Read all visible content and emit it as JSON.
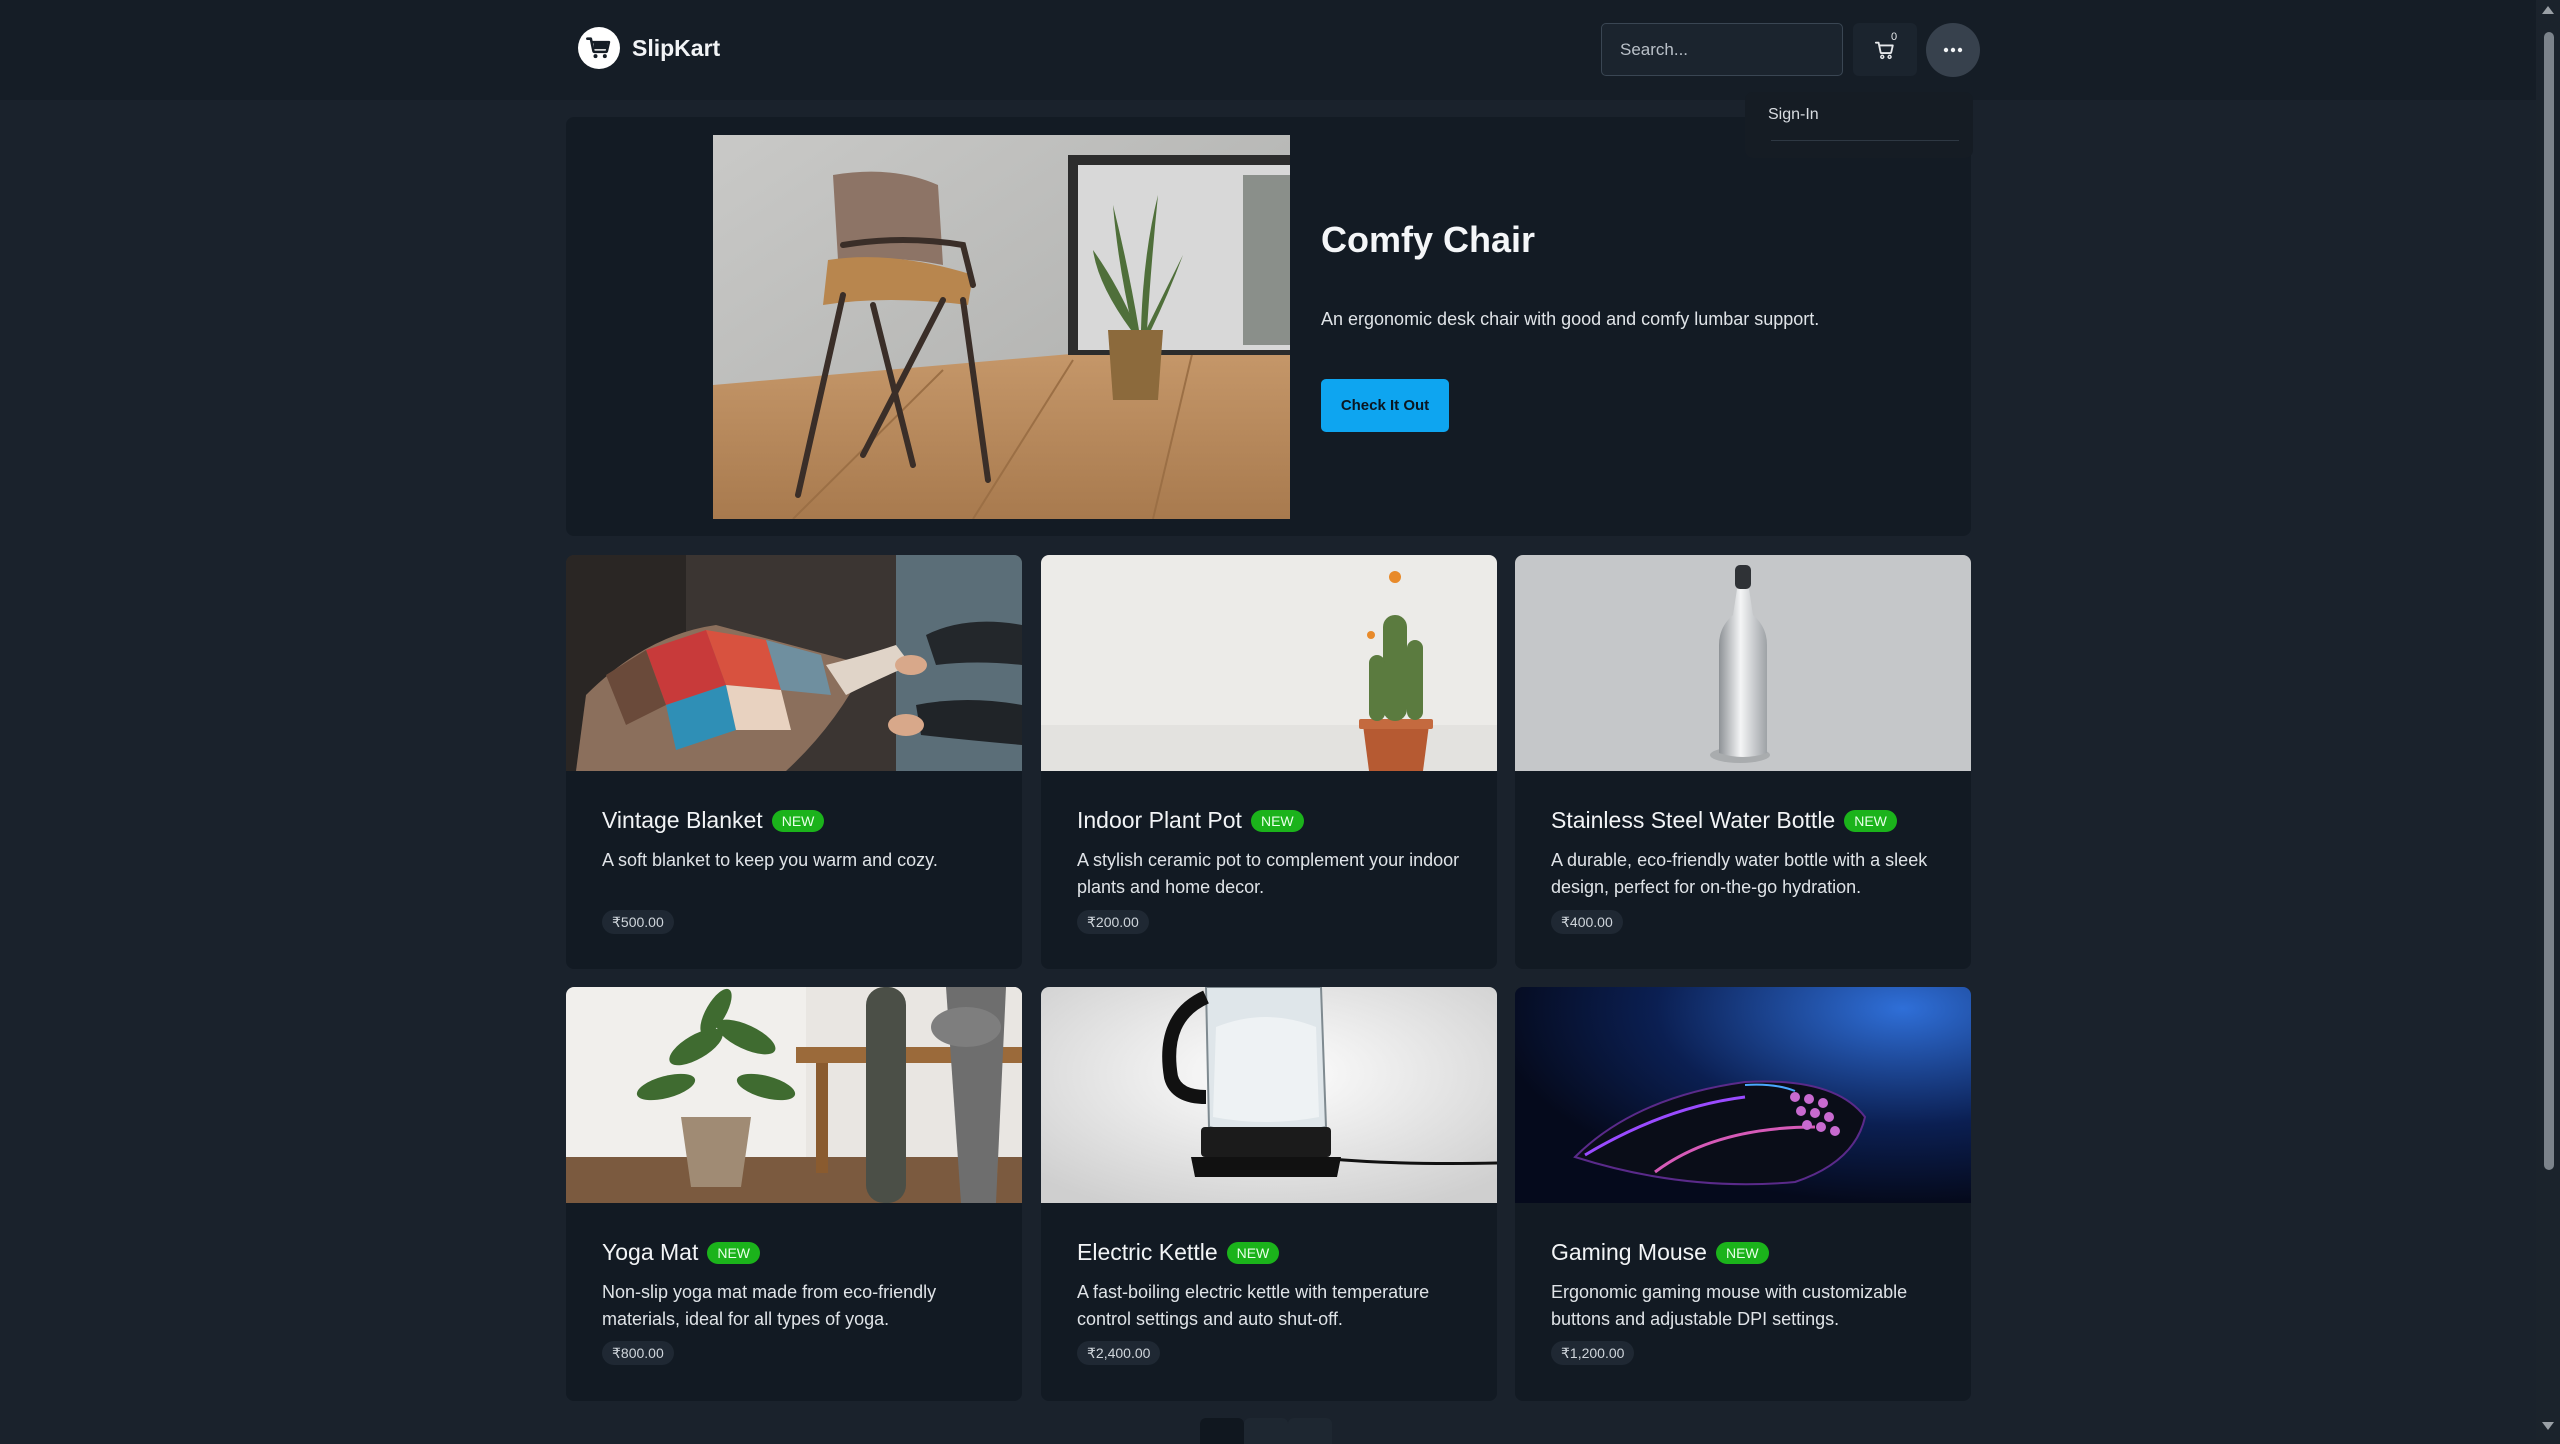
{
  "brand": {
    "name": "SlipKart",
    "logo_icon": "shopping-cart-icon"
  },
  "search": {
    "placeholder": "Search..."
  },
  "cart": {
    "icon": "cart-icon",
    "count": "0"
  },
  "menu": {
    "icon": "more-horizontal-icon"
  },
  "dropdown": {
    "items": [
      {
        "label": "Sign-In"
      }
    ]
  },
  "hero": {
    "title": "Comfy Chair",
    "description": "An ergonomic desk chair with good and comfy lumbar support.",
    "button_label": "Check It Out"
  },
  "products": [
    {
      "title": "Vintage Blanket",
      "badge": "NEW",
      "description": "A soft blanket to keep you warm and cozy.",
      "price": "₹500.00"
    },
    {
      "title": "Indoor Plant Pot",
      "badge": "NEW",
      "description": "A stylish ceramic pot to complement your indoor plants and home decor.",
      "price": "₹200.00"
    },
    {
      "title": "Stainless Steel Water Bottle",
      "badge": "NEW",
      "description": "A durable, eco-friendly water bottle with a sleek design, perfect for on-the-go hydration.",
      "price": "₹400.00"
    },
    {
      "title": "Yoga Mat",
      "badge": "NEW",
      "description": "Non-slip yoga mat made from eco-friendly materials, ideal for all types of yoga.",
      "price": "₹800.00"
    },
    {
      "title": "Electric Kettle",
      "badge": "NEW",
      "description": "A fast-boiling electric kettle with temperature control settings and auto shut-off.",
      "price": "₹2,400.00"
    },
    {
      "title": "Gaming Mouse",
      "badge": "NEW",
      "description": "Ergonomic gaming mouse with customizable buttons and adjustable DPI settings.",
      "price": "₹1,200.00"
    }
  ],
  "colors": {
    "accent": "#0ea5f0",
    "badge": "#1bb31b",
    "background": "#1a222c",
    "card": "#121a23"
  }
}
